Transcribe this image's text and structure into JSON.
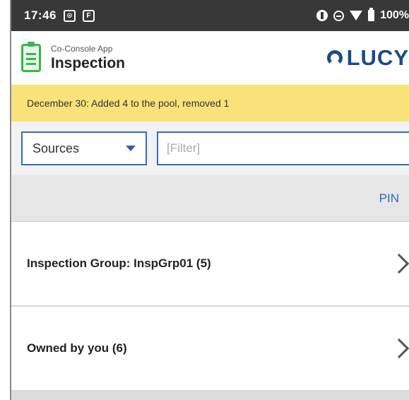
{
  "status_bar": {
    "time": "17:46",
    "icon1": "screen-record-icon",
    "icon2_letter": "F",
    "battery": "100%",
    "icons": [
      "data-saver-icon",
      "do-not-disturb-icon",
      "wifi-icon",
      "battery-icon"
    ]
  },
  "header": {
    "app_subtitle": "Co-Console App",
    "app_title": "Inspection",
    "app_icon": "clipboard-icon",
    "brand": "LUCY"
  },
  "notice": {
    "text": "December 30: Added 4 to the pool, removed 1"
  },
  "filters": {
    "source_selected": "Sources",
    "filter_placeholder": "[Filter]"
  },
  "pin_label": "PIN",
  "list": [
    {
      "label": "Inspection Group: InspGrp01 (5)"
    },
    {
      "label": "Owned by you (6)"
    }
  ],
  "colors": {
    "status_bar": "#383838",
    "accent_green": "#3ab549",
    "brand_blue": "#1a4a8a",
    "notice_yellow": "#f9e27a",
    "link_blue": "#2a6bb8"
  }
}
